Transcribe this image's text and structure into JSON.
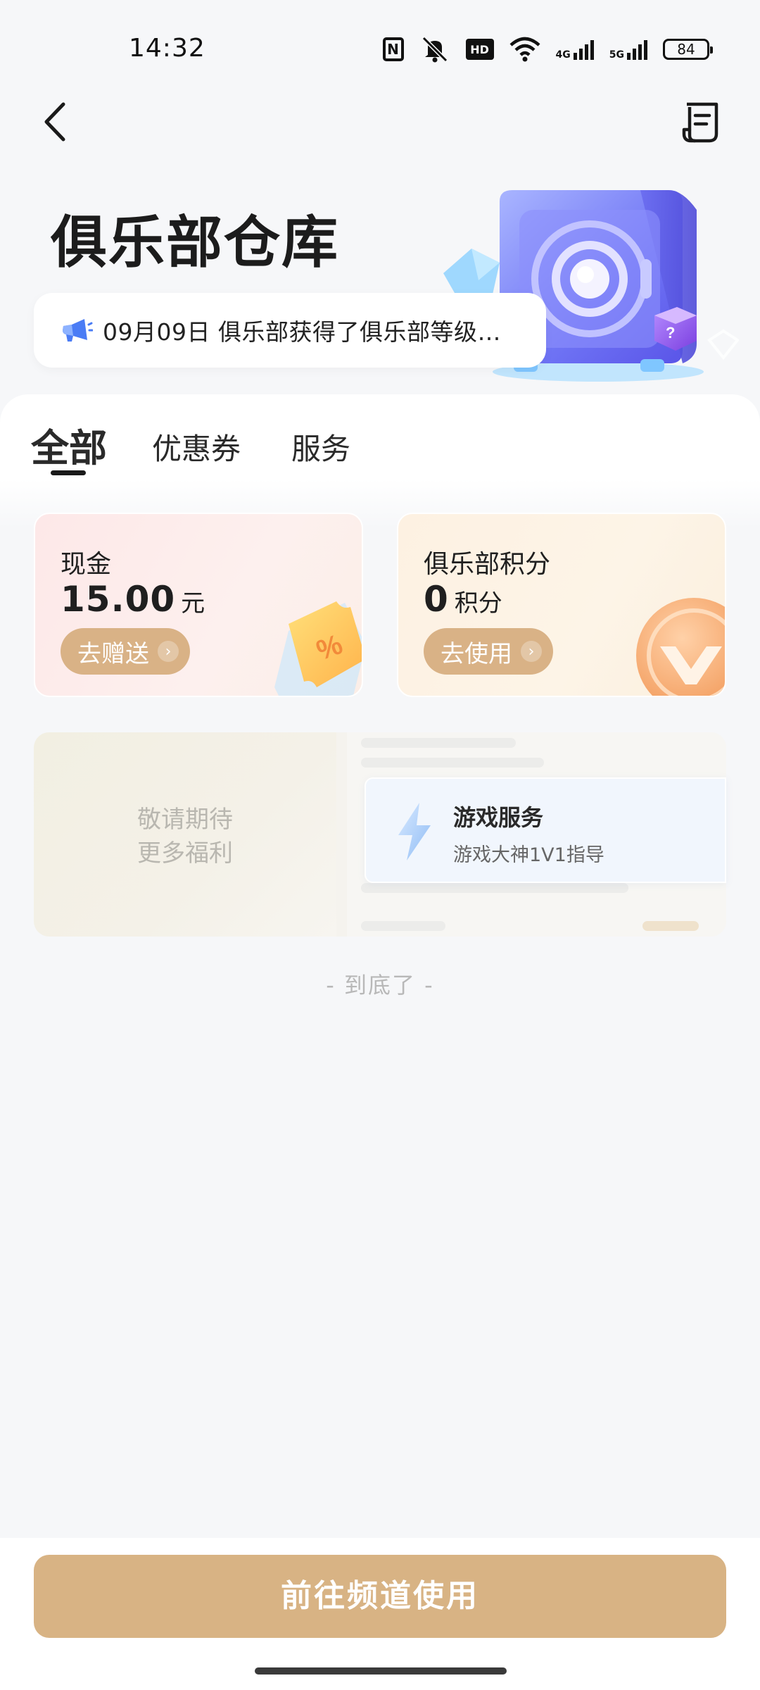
{
  "status_bar": {
    "time": "14:32",
    "battery": "84",
    "network_1": "4G",
    "network_2": "5G",
    "hd_label": "HD"
  },
  "header": {
    "title": "俱乐部仓库",
    "back_icon": "back-arrow-icon",
    "doc_icon": "document-list-icon"
  },
  "notice": {
    "icon": "megaphone-icon",
    "text": "09月09日 俱乐部获得了俱乐部等级…"
  },
  "tabs": [
    {
      "label": "全部",
      "active": true
    },
    {
      "label": "优惠券",
      "active": false
    },
    {
      "label": "服务",
      "active": false
    }
  ],
  "cards": {
    "cash": {
      "label": "现金",
      "value": "15.00",
      "unit": "元",
      "button": "去赠送"
    },
    "points": {
      "label": "俱乐部积分",
      "value": "0",
      "unit": "积分",
      "button": "去使用"
    }
  },
  "future": {
    "line1": "敬请期待",
    "line2": "更多福利"
  },
  "service_card": {
    "title": "游戏服务",
    "subtitle": "游戏大神1V1指导"
  },
  "end_text": "-  到底了  -",
  "primary_button": "前往频道使用",
  "colors": {
    "accent_gold": "#d8b384",
    "background": "#f6f7f9"
  }
}
